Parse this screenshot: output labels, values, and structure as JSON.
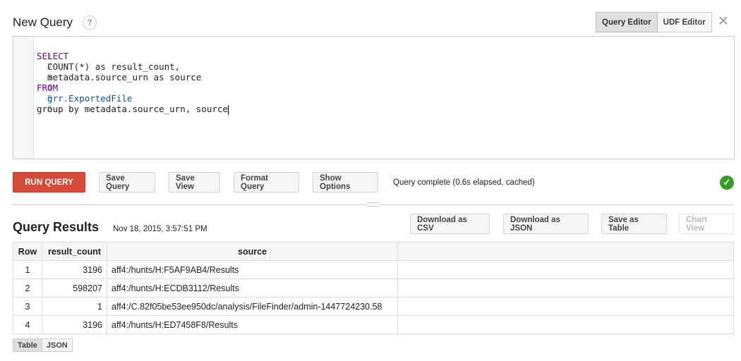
{
  "header": {
    "title": "New Query",
    "help_symbol": "?"
  },
  "editor_tabs": [
    {
      "label": "Query Editor",
      "active": true
    },
    {
      "label": "UDF Editor",
      "active": false
    }
  ],
  "close_symbol": "✕",
  "editor": {
    "lines": [
      {
        "num": "1",
        "text": "SELECT"
      },
      {
        "num": "2",
        "text": "  COUNT(*) as result_count,"
      },
      {
        "num": "3",
        "text": "  metadata.source_urn as source"
      },
      {
        "num": "4",
        "text": "FROM"
      },
      {
        "num": "5",
        "text": "  grr.ExportedFile"
      },
      {
        "num": "6",
        "text": "group by metadata.source_urn, source"
      }
    ]
  },
  "toolbar": {
    "run_label": "RUN QUERY",
    "save_query_label": "Save Query",
    "save_view_label": "Save View",
    "format_query_label": "Format Query",
    "show_options_label": "Show Options",
    "status": "Query complete (0.6s elapsed, cached)",
    "status_icon": "check-icon",
    "status_color": "#3b9b25",
    "run_color": "#d44b3a"
  },
  "results": {
    "title": "Query Results",
    "timestamp": "Nov 18, 2015, 3:57:51 PM",
    "download_csv_label": "Download as CSV",
    "download_json_label": "Download as JSON",
    "save_table_label": "Save as Table",
    "chart_view_label": "Chart View",
    "columns": [
      "Row",
      "result_count",
      "source"
    ],
    "rows": [
      {
        "row": "1",
        "result_count": "3196",
        "source": "aff4:/hunts/H:F5AF9AB4/Results"
      },
      {
        "row": "2",
        "result_count": "598207",
        "source": "aff4:/hunts/H:ECDB3112/Results"
      },
      {
        "row": "3",
        "result_count": "1",
        "source": "aff4:/C.82f05be53ee950dc/analysis/FileFinder/admin-1447724230.58"
      },
      {
        "row": "4",
        "result_count": "3196",
        "source": "aff4:/hunts/H:ED7458F8/Results"
      }
    ]
  },
  "view_tabs": [
    {
      "label": "Table",
      "active": true
    },
    {
      "label": "JSON",
      "active": false
    }
  ]
}
